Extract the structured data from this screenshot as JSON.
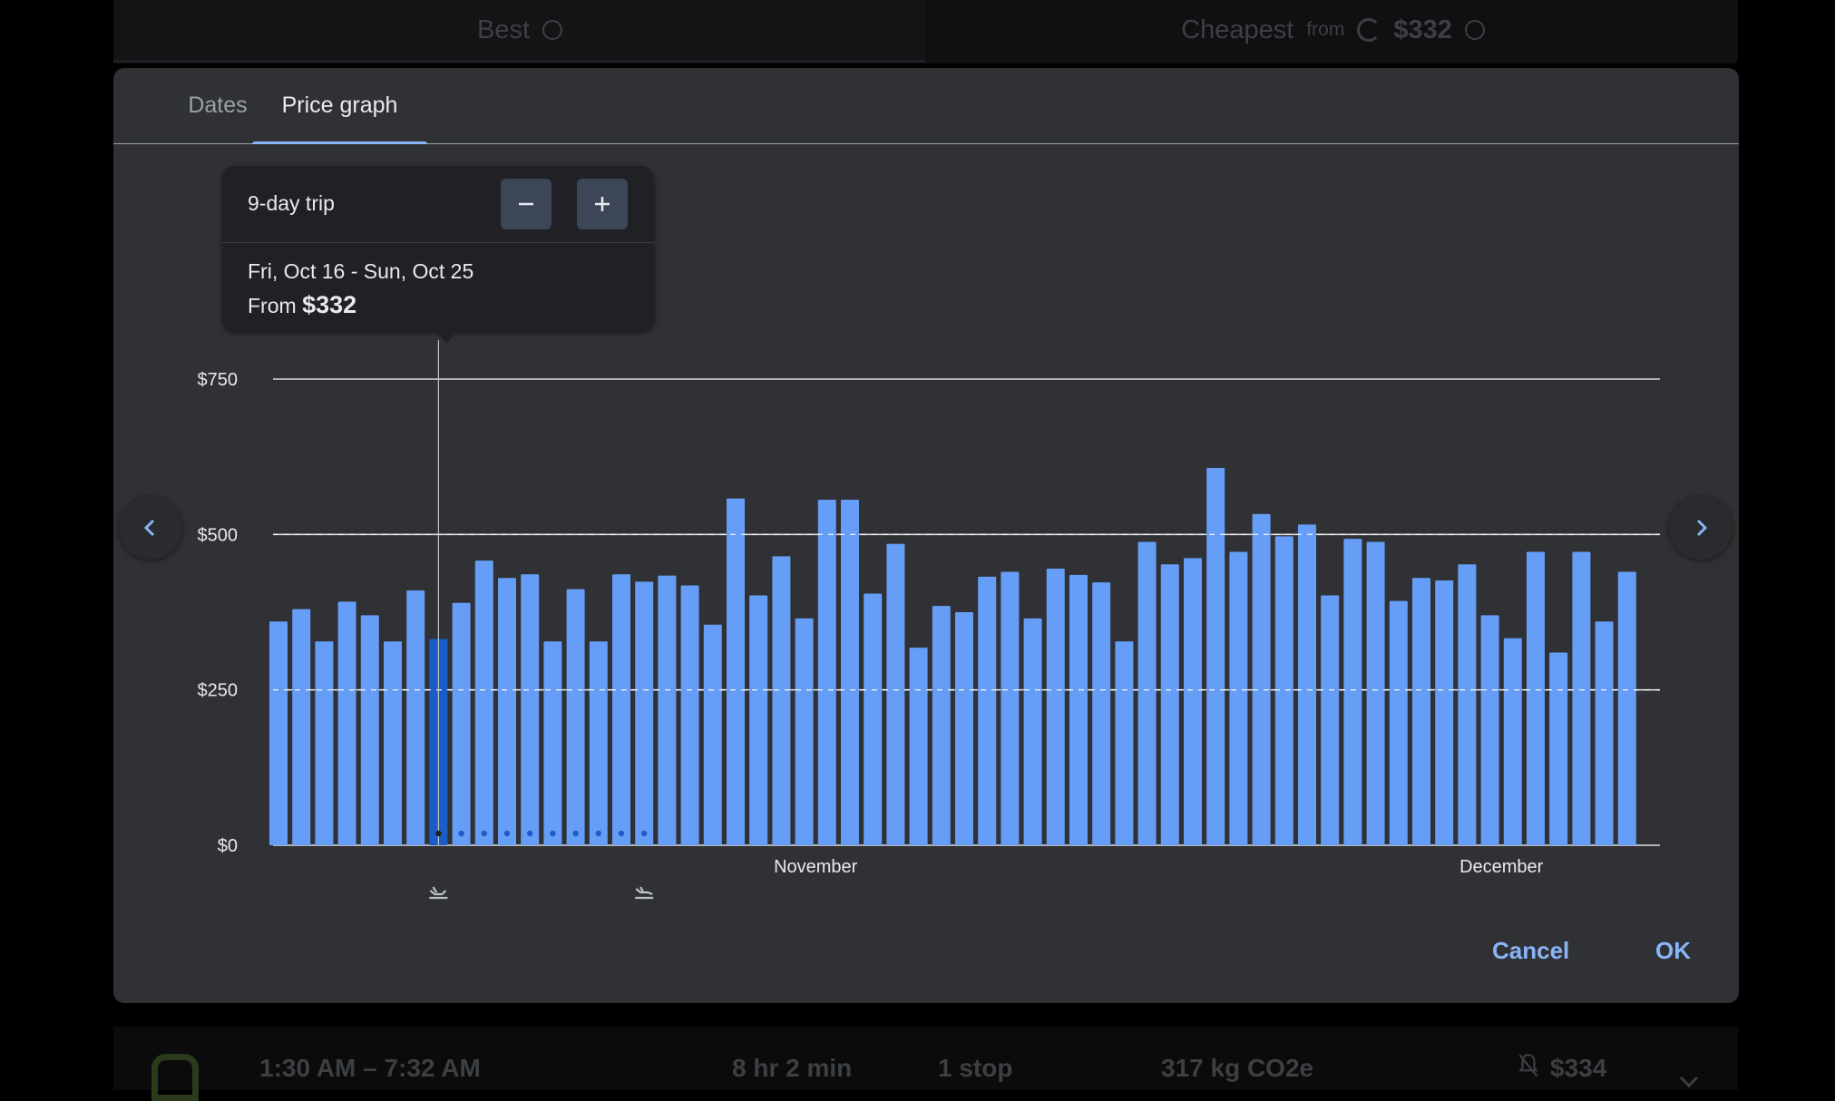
{
  "background": {
    "tabs": {
      "best_label": "Best",
      "cheapest_label": "Cheapest",
      "cheapest_from": "from",
      "cheapest_price": "$332"
    },
    "flight_row": {
      "times": "1:30 AM – 7:32 AM",
      "duration": "8 hr 2 min",
      "stops": "1 stop",
      "emissions": "317 kg CO2e",
      "price": "$334"
    }
  },
  "modal": {
    "tabs": [
      {
        "label": "Dates",
        "active": false
      },
      {
        "label": "Price graph",
        "active": true
      }
    ],
    "tooltip": {
      "trip_length": "9-day trip",
      "dates": "Fri, Oct 16 - Sun, Oct 25",
      "from_label": "From",
      "price": "$332"
    },
    "cancel_label": "Cancel",
    "ok_label": "OK"
  },
  "colors": {
    "bar": "#669df6",
    "bar_selected": "#1a5dc6",
    "accent": "#8ab4f8",
    "modal_bg": "#303134"
  },
  "chart_data": {
    "type": "bar",
    "title": "",
    "xlabel": "",
    "ylabel": "",
    "ylim": [
      0,
      750
    ],
    "yticks": [
      0,
      250,
      500,
      750
    ],
    "ytick_labels": [
      "$0",
      "$250",
      "$500",
      "$750"
    ],
    "month_labels": [
      {
        "label": "November",
        "index": 23.5
      },
      {
        "label": "December",
        "index": 53.5
      }
    ],
    "selected_index": 7,
    "trip_days": 9,
    "values": [
      360,
      380,
      328,
      392,
      370,
      328,
      410,
      332,
      390,
      458,
      430,
      436,
      328,
      412,
      328,
      436,
      424,
      434,
      418,
      355,
      558,
      402,
      465,
      365,
      556,
      556,
      405,
      485,
      318,
      385,
      375,
      432,
      440,
      365,
      445,
      435,
      423,
      328,
      488,
      452,
      462,
      607,
      472,
      533,
      497,
      516,
      402,
      493,
      488,
      393,
      430,
      426,
      452,
      370,
      333,
      472,
      310,
      472,
      360,
      440
    ]
  },
  "icons": [
    "chevron-left-icon",
    "chevron-right-icon",
    "minus-icon",
    "plus-icon",
    "departure-icon",
    "landing-icon"
  ]
}
